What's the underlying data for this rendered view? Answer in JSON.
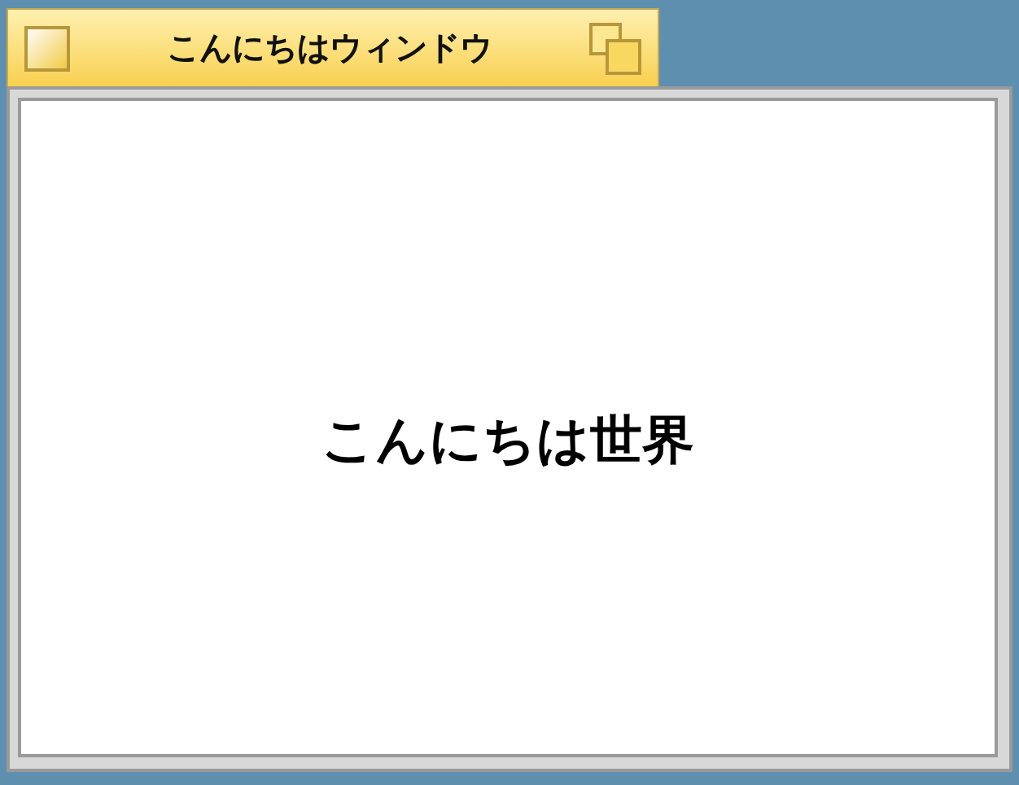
{
  "window": {
    "title": "こんにちはウィンドウ"
  },
  "content": {
    "text": "こんにちは世界"
  }
}
